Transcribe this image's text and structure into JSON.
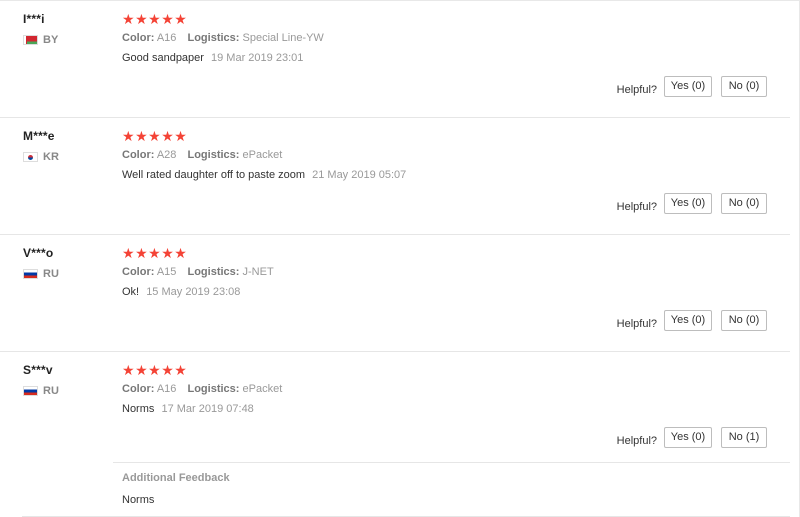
{
  "labels": {
    "color": "Color:",
    "logistics": "Logistics:",
    "helpful": "Helpful?",
    "additional_feedback": "Additional Feedback"
  },
  "star_glyph": "★",
  "reviews": [
    {
      "user": "I***i",
      "country": "BY",
      "flag_icon": "belarus-flag-icon",
      "rating": 5,
      "color": "A16",
      "logistics": "Special Line-YW",
      "text": "Good sandpaper",
      "date": "19 Mar 2019 23:01",
      "yes": "Yes (0)",
      "no": "No (0)"
    },
    {
      "user": "M***e",
      "country": "KR",
      "flag_icon": "south-korea-flag-icon",
      "rating": 5,
      "color": "A28",
      "logistics": "ePacket",
      "text": "Well rated daughter off to paste zoom",
      "date": "21 May 2019 05:07",
      "yes": "Yes (0)",
      "no": "No (0)"
    },
    {
      "user": "V***o",
      "country": "RU",
      "flag_icon": "russia-flag-icon",
      "rating": 5,
      "color": "A15",
      "logistics": "J-NET",
      "text": "Ok!",
      "date": "15 May 2019 23:08",
      "yes": "Yes (0)",
      "no": "No (0)"
    },
    {
      "user": "S***v",
      "country": "RU",
      "flag_icon": "russia-flag-icon",
      "rating": 5,
      "color": "A16",
      "logistics": "ePacket",
      "text": "Norms",
      "date": "17 Mar 2019 07:48",
      "yes": "Yes (0)",
      "no": "No (1)",
      "additional_feedback": "Norms"
    }
  ],
  "colors": {
    "star": "#f44336",
    "muted": "#999999",
    "border": "#e6e6e6"
  }
}
